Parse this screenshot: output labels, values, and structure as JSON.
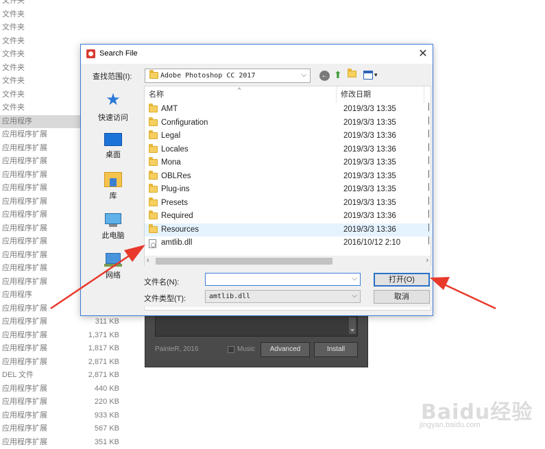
{
  "background_list": {
    "rows": [
      {
        "type": "文件夹",
        "size": ""
      },
      {
        "type": "文件夹",
        "size": ""
      },
      {
        "type": "文件夹",
        "size": ""
      },
      {
        "type": "文件夹",
        "size": ""
      },
      {
        "type": "文件夹",
        "size": ""
      },
      {
        "type": "文件夹",
        "size": ""
      },
      {
        "type": "文件夹",
        "size": ""
      },
      {
        "type": "文件夹",
        "size": ""
      },
      {
        "type": "文件夹",
        "size": ""
      },
      {
        "type": "应用程序",
        "size": "",
        "selected": true
      },
      {
        "type": "应用程序扩展",
        "size": ""
      },
      {
        "type": "应用程序扩展",
        "size": ""
      },
      {
        "type": "应用程序扩展",
        "size": ""
      },
      {
        "type": "应用程序扩展",
        "size": ""
      },
      {
        "type": "应用程序扩展",
        "size": ""
      },
      {
        "type": "应用程序扩展",
        "size": ""
      },
      {
        "type": "应用程序扩展",
        "size": ""
      },
      {
        "type": "应用程序扩展",
        "size": ""
      },
      {
        "type": "应用程序扩展",
        "size": ""
      },
      {
        "type": "应用程序扩展",
        "size": ""
      },
      {
        "type": "应用程序扩展",
        "size": ""
      },
      {
        "type": "应用程序扩展",
        "size": ""
      },
      {
        "type": "应用程序",
        "size": ""
      },
      {
        "type": "应用程序扩展",
        "size": ""
      },
      {
        "type": "应用程序扩展",
        "size": "311 KB"
      },
      {
        "type": "应用程序扩展",
        "size": "1,371 KB"
      },
      {
        "type": "应用程序扩展",
        "size": "1,817 KB"
      },
      {
        "type": "应用程序扩展",
        "size": "2,871 KB"
      },
      {
        "type": "DEL 文件",
        "size": "2,871 KB"
      },
      {
        "type": "应用程序扩展",
        "size": "440 KB"
      },
      {
        "type": "应用程序扩展",
        "size": "220 KB"
      },
      {
        "type": "应用程序扩展",
        "size": "933 KB"
      },
      {
        "type": "应用程序扩展",
        "size": "567 KB"
      },
      {
        "type": "应用程序扩展",
        "size": "351 KB"
      }
    ]
  },
  "installer": {
    "credit": "PainteR, 2016",
    "music_label": "Music",
    "advanced_label": "Advanced",
    "install_label": "Install"
  },
  "dialog": {
    "title": "Search File",
    "close_glyph": "✕",
    "lookin_label": "查找范围(I):",
    "lookin_value": "Adobe Photoshop CC 2017",
    "places": [
      {
        "label": "快速访问",
        "icon": "star-icon"
      },
      {
        "label": "桌面",
        "icon": "desktop-icon"
      },
      {
        "label": "库",
        "icon": "library-icon"
      },
      {
        "label": "此电脑",
        "icon": "computer-icon"
      },
      {
        "label": "网络",
        "icon": "network-icon"
      }
    ],
    "columns": {
      "name": "名称",
      "date": "修改日期"
    },
    "files": [
      {
        "name": "AMT",
        "date": "2019/3/3 13:35",
        "kind": "folder"
      },
      {
        "name": "Configuration",
        "date": "2019/3/3 13:35",
        "kind": "folder"
      },
      {
        "name": "Legal",
        "date": "2019/3/3 13:36",
        "kind": "folder"
      },
      {
        "name": "Locales",
        "date": "2019/3/3 13:36",
        "kind": "folder"
      },
      {
        "name": "Mona",
        "date": "2019/3/3 13:35",
        "kind": "folder"
      },
      {
        "name": "OBLRes",
        "date": "2019/3/3 13:35",
        "kind": "folder"
      },
      {
        "name": "Plug-ins",
        "date": "2019/3/3 13:35",
        "kind": "folder"
      },
      {
        "name": "Presets",
        "date": "2019/3/3 13:35",
        "kind": "folder"
      },
      {
        "name": "Required",
        "date": "2019/3/3 13:36",
        "kind": "folder"
      },
      {
        "name": "Resources",
        "date": "2019/3/3 13:36",
        "kind": "folder",
        "highlighted": true
      },
      {
        "name": "amtlib.dll",
        "date": "2016/10/12 2:10",
        "kind": "file"
      }
    ],
    "filename_label": "文件名(N):",
    "filename_value": "",
    "filetype_label": "文件类型(T):",
    "filetype_value": "amtlib.dll",
    "open_label": "打开(O)",
    "cancel_label": "取消"
  },
  "watermark": {
    "logo": "Baidu经验",
    "url": "jingyan.baidu.com"
  },
  "colors": {
    "accent": "#2a70c9",
    "arrow": "#e8392b",
    "highlight_row": "#e5f3ff"
  }
}
